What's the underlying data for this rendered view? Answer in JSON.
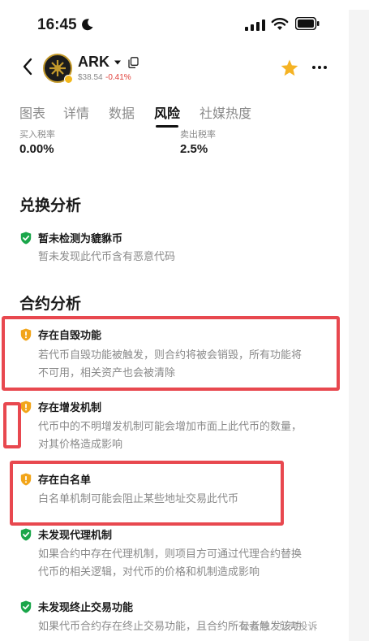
{
  "status_bar": {
    "time": "16:45"
  },
  "header": {
    "token_name": "ARK",
    "price": "$38.54",
    "change": "-0.41%"
  },
  "tabs": [
    {
      "label": "图表",
      "active": false
    },
    {
      "label": "详情",
      "active": false
    },
    {
      "label": "数据",
      "active": false
    },
    {
      "label": "风险",
      "active": true
    },
    {
      "label": "社媒热度",
      "active": false
    }
  ],
  "tax": {
    "buy_label": "买入税率",
    "buy_value": "0.00%",
    "sell_label": "卖出税率",
    "sell_value": "2.5%"
  },
  "exchange_analysis": {
    "title": "兑换分析",
    "items": [
      {
        "status": "safe",
        "title": "暂未检测为貔貅币",
        "desc_lines": [
          "暂未发现此代币含有恶意代码"
        ]
      }
    ]
  },
  "contract_analysis": {
    "title": "合约分析",
    "items": [
      {
        "status": "warning",
        "title": "存在自毁功能",
        "desc_lines": [
          "若代币自毁功能被触发，则合约将被会销毁，所有功能将",
          "不可用，相关资产也会被清除"
        ]
      },
      {
        "status": "warning",
        "title": "存在增发机制",
        "desc_lines": [
          "代币中的不明增发机制可能会增加市面上此代币的数量，",
          "对其价格造成影响"
        ]
      },
      {
        "status": "warning",
        "title": "存在白名单",
        "desc_lines": [
          "白名单机制可能会阻止某些地址交易此代币"
        ]
      },
      {
        "status": "safe",
        "title": "未发现代理机制",
        "desc_lines": [
          "如果合约中存在代理机制，则项目方可通过代理合约替换",
          "代币的相关逻辑，对代币的价格和机制造成影响"
        ]
      },
      {
        "status": "safe",
        "title": "未发现终止交易功能",
        "desc_lines": [
          "如果代币合约存在终止交易功能，且合约所有者触发该功"
        ]
      }
    ]
  },
  "watermark": "公众号 · 贝壳投诉",
  "colors": {
    "safe": "#1aa64a",
    "warning": "#f2a51a",
    "highlight": "#e8484f",
    "negative": "#e0413b",
    "star": "#f5b324"
  },
  "icons": {
    "moon": "moon-icon",
    "signal": "signal-icon",
    "wifi": "wifi-icon",
    "battery": "battery-icon",
    "back": "back-icon",
    "caret": "caret-down-icon",
    "copy": "copy-icon",
    "star": "star-icon",
    "more": "more-icon",
    "safe": "shield-check-icon",
    "warning": "shield-warning-icon"
  }
}
